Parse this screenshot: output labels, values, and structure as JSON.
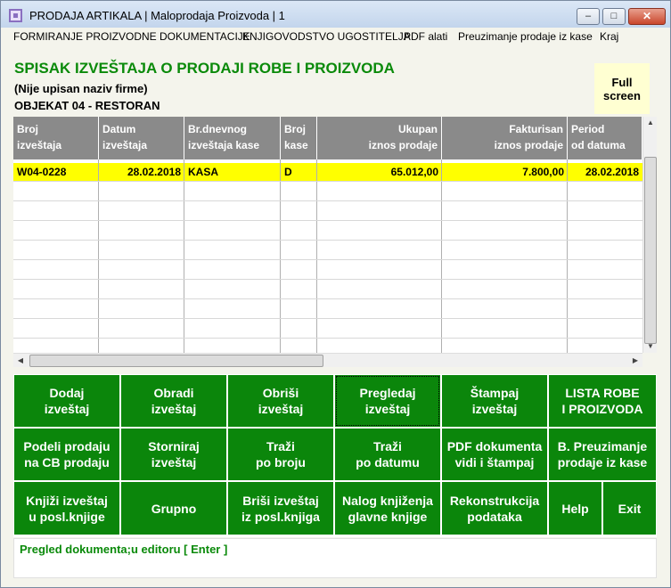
{
  "window": {
    "title": "PRODAJA ARTIKALA | Maloprodaja Proizvoda | 1",
    "min_glyph": "–",
    "max_glyph": "□",
    "close_glyph": "✕"
  },
  "menu": [
    "FORMIRANJE PROIZVODNE DOKUMENTACIJE",
    "KNJIGOVODSTVO UGOSTITELJA",
    "PDF alati",
    "Preuzimanje prodaje iz kase",
    "Kraj"
  ],
  "header": {
    "title": "SPISAK IZVEŠTAJA O PRODAJI ROBE I PROIZVODA",
    "firm": "(Nije upisan naziv firme)",
    "object": "OBJEKAT  04 - RESTORAN",
    "full_screen_line1": "Full",
    "full_screen_line2": "screen"
  },
  "table": {
    "columns": [
      {
        "l1": "Broj",
        "l2": "izveštaja"
      },
      {
        "l1": "Datum",
        "l2": "izveštaja"
      },
      {
        "l1": "Br.dnevnog",
        "l2": "izveštaja kase"
      },
      {
        "l1": "Broj",
        "l2": "kase"
      },
      {
        "l1": "Ukupan",
        "l2": "iznos prodaje"
      },
      {
        "l1": "Fakturisan",
        "l2": "iznos prodaje"
      },
      {
        "l1": "Period",
        "l2": "od datuma"
      }
    ],
    "rows": [
      [
        "W04-0228",
        "28.02.2018",
        "KASA",
        "D",
        "65.012,00",
        "7.800,00",
        "28.02.2018"
      ]
    ],
    "selected_row": 0
  },
  "scroll": {
    "up": "▲",
    "down": "▼",
    "left": "◀",
    "right": "▶"
  },
  "buttons": [
    [
      "Dodaj\nizveštaj",
      "Obradi\nizveštaj",
      "Obriši\nizveštaj",
      "Pregledaj\nizveštaj",
      "Štampaj\nizveštaj",
      "LISTA ROBE\nI PROIZVODA"
    ],
    [
      "Podeli prodaju\nna CB prodaju",
      "Storniraj\nizveštaj",
      "Traži\npo broju",
      "Traži\npo datumu",
      "PDF dokumenta\nvidi i štampaj",
      "B. Preuzimanje\nprodaje iz kase"
    ],
    [
      "Knjiži izveštaj\nu posl.knjige",
      "Grupno",
      "Briši izveštaj\niz posl.knjiga",
      "Nalog knjiženja\nglavne knjige",
      "Rekonstrukcija\npodataka",
      "Help",
      "Exit"
    ]
  ],
  "status": "Pregled dokumenta;u editoru [ Enter ]"
}
